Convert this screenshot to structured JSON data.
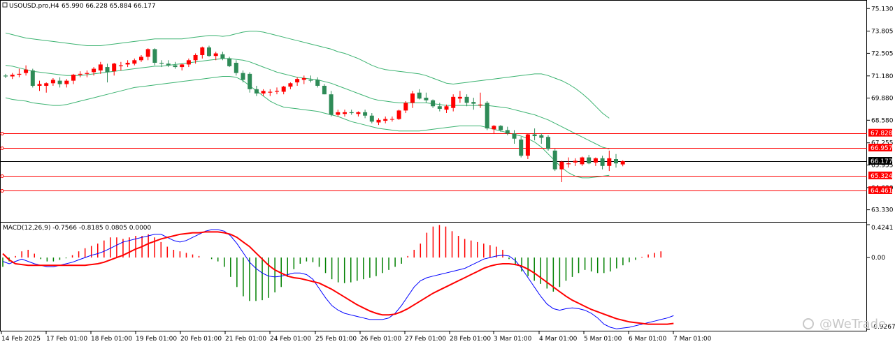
{
  "header": {
    "symbol_text": "USOUSD.pro,H4",
    "ohlc_text": "65.990 66.228 65.884 66.177"
  },
  "macd": {
    "label": "MACD(12,26,9) -0.7566 -0.8185 0.0805 0.0000",
    "axis_labels": [
      "0.4241",
      "0.00",
      "-0.9267"
    ],
    "signal_color": "#ff0000",
    "macd_color": "#0000ff",
    "hist_pos_color": "#ff0000",
    "hist_neg_color": "#008000",
    "ylim": [
      -0.9267,
      0.4241
    ],
    "histogram": [
      -0.12,
      -0.05,
      0.02,
      0.08,
      0.1,
      0.05,
      -0.02,
      -0.05,
      -0.05,
      -0.03,
      -0.01,
      0.03,
      0.08,
      0.12,
      0.15,
      0.18,
      0.22,
      0.26,
      0.26,
      0.24,
      0.26,
      0.28,
      0.28,
      0.3,
      0.26,
      0.2,
      0.14,
      0.1,
      0.08,
      0.06,
      0.04,
      0.02,
      0.0,
      -0.02,
      -0.05,
      -0.12,
      -0.25,
      -0.38,
      -0.5,
      -0.56,
      -0.56,
      -0.55,
      -0.52,
      -0.45,
      -0.38,
      -0.25,
      -0.15,
      -0.08,
      -0.05,
      -0.06,
      -0.12,
      -0.2,
      -0.28,
      -0.32,
      -0.33,
      -0.32,
      -0.3,
      -0.28,
      -0.26,
      -0.24,
      -0.2,
      -0.16,
      -0.12,
      -0.08,
      0.02,
      0.1,
      0.18,
      0.32,
      0.4,
      0.42,
      0.4,
      0.34,
      0.28,
      0.24,
      0.22,
      0.2,
      0.18,
      0.16,
      0.14,
      0.1,
      -0.02,
      -0.1,
      -0.18,
      -0.24,
      -0.3,
      -0.34,
      -0.4,
      -0.44,
      -0.38,
      -0.3,
      -0.25,
      -0.2,
      -0.16,
      -0.18,
      -0.2,
      -0.2,
      -0.18,
      -0.14,
      -0.1,
      -0.06,
      -0.03,
      0.01,
      0.04,
      0.06,
      0.08
    ],
    "macd_line": [
      -0.05,
      -0.08,
      -0.05,
      -0.02,
      -0.05,
      -0.08,
      -0.1,
      -0.12,
      -0.12,
      -0.1,
      -0.08,
      -0.06,
      -0.03,
      0.0,
      0.03,
      0.05,
      0.08,
      0.12,
      0.16,
      0.2,
      0.22,
      0.24,
      0.26,
      0.28,
      0.3,
      0.3,
      0.26,
      0.22,
      0.2,
      0.22,
      0.26,
      0.3,
      0.34,
      0.36,
      0.36,
      0.34,
      0.28,
      0.18,
      0.06,
      -0.06,
      -0.14,
      -0.2,
      -0.24,
      -0.25,
      -0.24,
      -0.22,
      -0.2,
      -0.2,
      -0.22,
      -0.28,
      -0.4,
      -0.52,
      -0.62,
      -0.68,
      -0.72,
      -0.74,
      -0.76,
      -0.78,
      -0.8,
      -0.8,
      -0.8,
      -0.78,
      -0.72,
      -0.62,
      -0.5,
      -0.38,
      -0.3,
      -0.26,
      -0.24,
      -0.22,
      -0.2,
      -0.18,
      -0.16,
      -0.14,
      -0.1,
      -0.06,
      -0.02,
      0.0,
      0.02,
      0.03,
      0.02,
      -0.04,
      -0.14,
      -0.26,
      -0.38,
      -0.5,
      -0.6,
      -0.66,
      -0.68,
      -0.66,
      -0.65,
      -0.66,
      -0.68,
      -0.72,
      -0.78,
      -0.86,
      -0.9,
      -0.92,
      -0.91,
      -0.9,
      -0.88,
      -0.86,
      -0.84,
      -0.82,
      -0.8,
      -0.78,
      -0.75
    ],
    "signal_line": [
      0.05,
      -0.03,
      -0.08,
      -0.09,
      -0.1,
      -0.1,
      -0.1,
      -0.1,
      -0.1,
      -0.1,
      -0.1,
      -0.1,
      -0.1,
      -0.1,
      -0.09,
      -0.08,
      -0.06,
      -0.03,
      0.0,
      0.03,
      0.07,
      0.11,
      0.14,
      0.18,
      0.21,
      0.24,
      0.26,
      0.28,
      0.3,
      0.31,
      0.32,
      0.32,
      0.33,
      0.33,
      0.33,
      0.32,
      0.3,
      0.26,
      0.2,
      0.14,
      0.06,
      -0.02,
      -0.1,
      -0.16,
      -0.2,
      -0.24,
      -0.26,
      -0.27,
      -0.29,
      -0.31,
      -0.33,
      -0.37,
      -0.41,
      -0.46,
      -0.51,
      -0.56,
      -0.61,
      -0.65,
      -0.69,
      -0.72,
      -0.74,
      -0.74,
      -0.73,
      -0.7,
      -0.66,
      -0.61,
      -0.56,
      -0.51,
      -0.46,
      -0.42,
      -0.38,
      -0.34,
      -0.3,
      -0.26,
      -0.22,
      -0.18,
      -0.14,
      -0.11,
      -0.09,
      -0.08,
      -0.08,
      -0.09,
      -0.11,
      -0.15,
      -0.2,
      -0.26,
      -0.32,
      -0.38,
      -0.44,
      -0.5,
      -0.55,
      -0.59,
      -0.63,
      -0.67,
      -0.7,
      -0.73,
      -0.76,
      -0.79,
      -0.81,
      -0.83,
      -0.84,
      -0.85,
      -0.86,
      -0.86,
      -0.86,
      -0.86,
      -0.85
    ]
  },
  "price_axis": {
    "labels": [
      "75.130",
      "73.805",
      "72.505",
      "71.180",
      "69.880",
      "68.580",
      "67.255",
      "65.955",
      "64.630",
      "63.330"
    ],
    "ylim": [
      62.7,
      75.55
    ]
  },
  "price_tags": [
    {
      "value": 67.828,
      "text": "67.828",
      "kind": "level",
      "color": "#ff0000"
    },
    {
      "value": 66.957,
      "text": "66.957",
      "kind": "level",
      "color": "#ff0000"
    },
    {
      "value": 66.177,
      "text": "66.177",
      "kind": "current",
      "color": "#000000"
    },
    {
      "value": 65.324,
      "text": "65.324",
      "kind": "level",
      "color": "#ff0000"
    },
    {
      "value": 64.461,
      "text": "64.461",
      "kind": "level",
      "color": "#ff0000"
    }
  ],
  "time_axis": {
    "labels": [
      "14 Feb 2025",
      "17 Feb 01:00",
      "18 Feb 01:00",
      "19 Feb 01:00",
      "20 Feb 01:00",
      "21 Feb 01:00",
      "24 Feb 01:00",
      "25 Feb 01:00",
      "26 Feb 01:00",
      "27 Feb 01:00",
      "28 Feb 01:00",
      "3 Mar 01:00",
      "4 Mar 01:00",
      "5 Mar 01:00",
      "6 Mar 01:00",
      "7 Mar 01:00"
    ]
  },
  "watermark": {
    "text": "@WeTrade"
  },
  "colors": {
    "bull": "#ff0000",
    "bear": "#2e8b57",
    "band": "#3cb371",
    "level": "#ff0000",
    "current": "#000000"
  },
  "chart_data": {
    "type": "candlestick",
    "timeframe": "H4",
    "symbol": "USOUSD.pro",
    "ylim": [
      62.7,
      75.55
    ],
    "candles": [
      [
        71.2,
        71.3,
        71.05,
        71.15
      ],
      [
        71.15,
        71.35,
        71.0,
        71.25
      ],
      [
        71.25,
        71.6,
        71.1,
        71.3
      ],
      [
        71.35,
        71.8,
        71.2,
        71.55
      ],
      [
        71.5,
        71.6,
        70.5,
        70.6
      ],
      [
        70.6,
        70.9,
        70.3,
        70.7
      ],
      [
        70.6,
        70.8,
        70.2,
        70.75
      ],
      [
        70.75,
        71.05,
        70.6,
        70.95
      ],
      [
        70.9,
        71.1,
        70.5,
        70.7
      ],
      [
        70.7,
        71.0,
        70.5,
        70.9
      ],
      [
        70.9,
        71.3,
        70.7,
        71.25
      ],
      [
        71.25,
        71.45,
        71.1,
        71.3
      ],
      [
        71.3,
        71.5,
        71.1,
        71.35
      ],
      [
        71.4,
        71.7,
        71.2,
        71.6
      ],
      [
        71.5,
        72.0,
        71.3,
        71.85
      ],
      [
        71.7,
        71.9,
        70.8,
        71.4
      ],
      [
        71.45,
        71.95,
        71.2,
        71.9
      ],
      [
        71.75,
        72.0,
        71.5,
        71.8
      ],
      [
        71.85,
        72.1,
        71.7,
        71.95
      ],
      [
        71.9,
        72.2,
        71.8,
        72.1
      ],
      [
        72.1,
        72.4,
        72.0,
        72.3
      ],
      [
        72.3,
        72.8,
        72.1,
        72.75
      ],
      [
        72.75,
        72.8,
        71.8,
        71.95
      ],
      [
        71.95,
        72.1,
        71.7,
        71.9
      ],
      [
        71.9,
        72.1,
        71.7,
        71.8
      ],
      [
        71.8,
        72.0,
        71.6,
        71.7
      ],
      [
        71.7,
        71.9,
        71.5,
        71.85
      ],
      [
        71.85,
        72.2,
        71.7,
        72.1
      ],
      [
        72.1,
        72.5,
        71.9,
        72.4
      ],
      [
        72.4,
        72.9,
        72.2,
        72.85
      ],
      [
        72.85,
        72.95,
        72.3,
        72.35
      ],
      [
        72.35,
        72.6,
        72.1,
        72.5
      ],
      [
        72.45,
        72.6,
        72.1,
        72.2
      ],
      [
        72.2,
        72.3,
        71.7,
        71.75
      ],
      [
        71.95,
        72.1,
        71.2,
        71.35
      ],
      [
        71.35,
        71.5,
        70.8,
        70.95
      ],
      [
        71.3,
        71.4,
        70.2,
        70.4
      ],
      [
        70.4,
        70.6,
        70.0,
        70.15
      ],
      [
        70.15,
        70.4,
        70.0,
        70.3
      ],
      [
        70.2,
        70.4,
        70.0,
        70.25
      ],
      [
        70.25,
        70.5,
        70.1,
        70.3
      ],
      [
        70.25,
        70.6,
        70.1,
        70.55
      ],
      [
        70.55,
        70.8,
        70.4,
        70.75
      ],
      [
        70.8,
        71.1,
        70.6,
        71.0
      ],
      [
        70.95,
        71.2,
        70.7,
        71.05
      ],
      [
        70.95,
        71.2,
        70.8,
        70.9
      ],
      [
        70.95,
        71.1,
        70.5,
        70.6
      ],
      [
        70.6,
        70.7,
        70.1,
        70.1
      ],
      [
        70.1,
        70.3,
        68.8,
        68.9
      ],
      [
        68.9,
        69.2,
        68.8,
        69.05
      ],
      [
        68.95,
        69.2,
        68.8,
        69.05
      ],
      [
        69.05,
        69.2,
        68.9,
        69.0
      ],
      [
        68.95,
        69.1,
        68.8,
        69.05
      ],
      [
        69.05,
        69.2,
        68.7,
        68.85
      ],
      [
        68.85,
        69.0,
        68.4,
        68.5
      ],
      [
        68.45,
        68.7,
        68.3,
        68.6
      ],
      [
        68.55,
        68.8,
        68.4,
        68.65
      ],
      [
        68.65,
        68.8,
        68.5,
        68.65
      ],
      [
        68.65,
        69.2,
        68.6,
        69.15
      ],
      [
        69.15,
        69.7,
        69.0,
        69.6
      ],
      [
        69.6,
        70.3,
        69.3,
        70.15
      ],
      [
        70.2,
        70.4,
        69.8,
        69.85
      ],
      [
        69.9,
        70.2,
        69.6,
        69.75
      ],
      [
        69.75,
        69.8,
        69.3,
        69.4
      ],
      [
        69.4,
        69.6,
        69.1,
        69.25
      ],
      [
        69.2,
        69.5,
        69.0,
        69.4
      ],
      [
        69.3,
        70.1,
        69.1,
        69.95
      ],
      [
        69.85,
        70.3,
        69.6,
        69.95
      ],
      [
        69.95,
        70.1,
        69.4,
        69.6
      ],
      [
        69.65,
        69.9,
        69.2,
        69.55
      ],
      [
        69.5,
        70.2,
        69.3,
        69.5
      ],
      [
        69.6,
        69.7,
        68.0,
        68.1
      ],
      [
        68.05,
        68.3,
        67.8,
        68.25
      ],
      [
        68.25,
        68.3,
        67.9,
        68.0
      ],
      [
        68.0,
        68.2,
        67.7,
        67.8
      ],
      [
        67.8,
        68.0,
        67.2,
        67.5
      ],
      [
        67.45,
        67.6,
        66.4,
        66.5
      ],
      [
        66.5,
        67.8,
        66.3,
        67.75
      ],
      [
        67.75,
        68.1,
        67.4,
        67.65
      ],
      [
        67.7,
        67.8,
        67.2,
        67.55
      ],
      [
        67.6,
        67.7,
        66.8,
        66.9
      ],
      [
        66.8,
        66.9,
        65.6,
        65.7
      ],
      [
        65.7,
        66.2,
        64.95,
        66.15
      ],
      [
        66.0,
        66.4,
        65.8,
        66.05
      ],
      [
        66.1,
        66.35,
        65.9,
        66.2
      ],
      [
        66.0,
        66.45,
        65.9,
        66.4
      ],
      [
        66.4,
        66.55,
        66.0,
        66.05
      ],
      [
        66.1,
        66.4,
        65.9,
        66.35
      ],
      [
        66.35,
        66.5,
        65.7,
        65.9
      ],
      [
        65.9,
        66.8,
        65.6,
        66.35
      ],
      [
        66.3,
        66.6,
        65.8,
        66.05
      ],
      [
        65.99,
        66.23,
        65.88,
        66.18
      ]
    ],
    "band_upper": [
      73.7,
      73.6,
      73.5,
      73.4,
      73.35,
      73.3,
      73.25,
      73.2,
      73.15,
      73.1,
      73.05,
      73.0,
      72.95,
      72.95,
      72.95,
      73.0,
      73.05,
      73.1,
      73.15,
      73.2,
      73.25,
      73.3,
      73.35,
      73.35,
      73.35,
      73.35,
      73.35,
      73.4,
      73.45,
      73.5,
      73.55,
      73.55,
      73.5,
      73.55,
      73.65,
      73.75,
      73.8,
      73.8,
      73.75,
      73.65,
      73.55,
      73.45,
      73.35,
      73.25,
      73.15,
      73.05,
      72.95,
      72.85,
      72.75,
      72.6,
      72.5,
      72.35,
      72.2,
      72.0,
      71.8,
      71.65,
      71.55,
      71.5,
      71.45,
      71.4,
      71.35,
      71.3,
      71.2,
      71.05,
      70.9,
      70.75,
      70.7,
      70.75,
      70.8,
      70.85,
      70.9,
      70.95,
      71.0,
      71.05,
      71.1,
      71.15,
      71.2,
      71.25,
      71.3,
      71.3,
      71.2,
      71.05,
      70.9,
      70.7,
      70.45,
      70.15,
      69.8,
      69.4,
      69.0,
      68.7
    ],
    "band_mid": [
      71.8,
      71.75,
      71.65,
      71.55,
      71.45,
      71.4,
      71.35,
      71.3,
      71.25,
      71.2,
      71.2,
      71.2,
      71.25,
      71.3,
      71.35,
      71.4,
      71.45,
      71.5,
      71.55,
      71.6,
      71.65,
      71.7,
      71.75,
      71.75,
      71.8,
      71.85,
      71.9,
      71.95,
      72.0,
      72.05,
      72.1,
      72.15,
      72.2,
      72.2,
      72.15,
      72.1,
      72.0,
      71.85,
      71.7,
      71.55,
      71.4,
      71.3,
      71.2,
      71.1,
      71.05,
      71.0,
      70.95,
      70.85,
      70.75,
      70.6,
      70.45,
      70.3,
      70.15,
      70.0,
      69.85,
      69.75,
      69.7,
      69.65,
      69.6,
      69.6,
      69.6,
      69.6,
      69.6,
      69.55,
      69.5,
      69.45,
      69.45,
      69.45,
      69.45,
      69.45,
      69.45,
      69.45,
      69.4,
      69.35,
      69.3,
      69.2,
      69.1,
      69.0,
      68.9,
      68.75,
      68.6,
      68.4,
      68.2,
      68.0,
      67.8,
      67.6,
      67.4,
      67.2,
      67.0,
      66.9
    ],
    "band_lower": [
      69.9,
      69.8,
      69.75,
      69.7,
      69.6,
      69.55,
      69.5,
      69.45,
      69.45,
      69.5,
      69.6,
      69.7,
      69.8,
      69.9,
      70.0,
      70.1,
      70.2,
      70.3,
      70.4,
      70.5,
      70.55,
      70.6,
      70.65,
      70.7,
      70.75,
      70.8,
      70.85,
      70.9,
      70.95,
      71.0,
      71.05,
      71.1,
      71.15,
      71.15,
      71.1,
      70.9,
      70.6,
      70.3,
      70.0,
      69.7,
      69.5,
      69.35,
      69.3,
      69.25,
      69.2,
      69.15,
      69.1,
      69.0,
      68.9,
      68.8,
      68.65,
      68.5,
      68.4,
      68.3,
      68.2,
      68.1,
      68.05,
      68.0,
      67.95,
      67.95,
      67.95,
      67.95,
      68.0,
      68.05,
      68.1,
      68.15,
      68.2,
      68.25,
      68.25,
      68.25,
      68.25,
      68.15,
      68.05,
      67.95,
      67.85,
      67.75,
      67.65,
      67.5,
      67.3,
      67.0,
      66.6,
      66.2,
      65.8,
      65.5,
      65.3,
      65.2,
      65.2,
      65.25,
      65.3,
      65.35
    ]
  }
}
